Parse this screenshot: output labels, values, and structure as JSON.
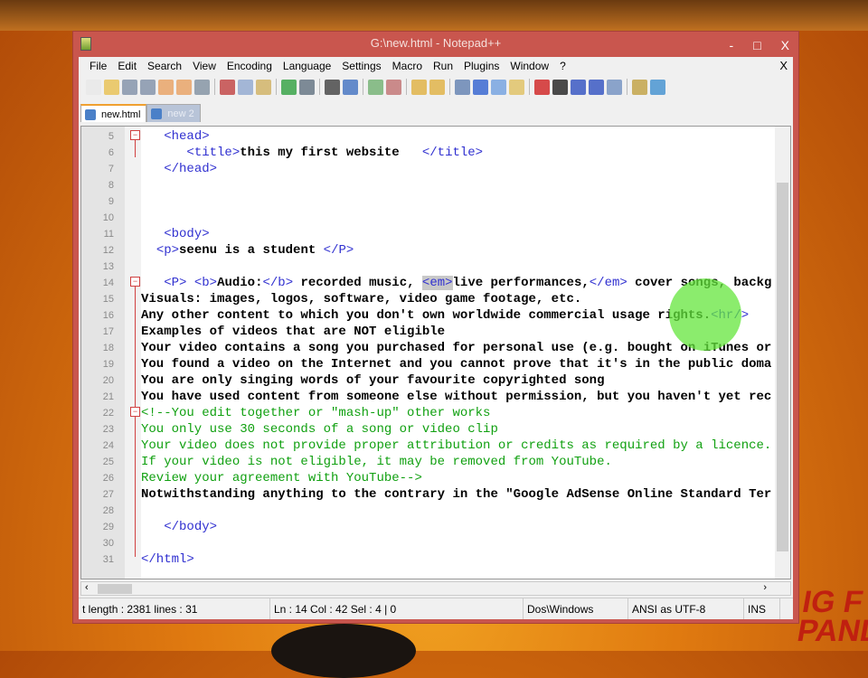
{
  "window": {
    "title": "G:\\new.html - Notepad++",
    "minimize": "-",
    "maximize": "□",
    "close": "X"
  },
  "menu": [
    "File",
    "Edit",
    "Search",
    "View",
    "Encoding",
    "Language",
    "Settings",
    "Macro",
    "Run",
    "Plugins",
    "Window",
    "?"
  ],
  "menu_close": "X",
  "tabs": [
    {
      "label": "new.html",
      "active": true
    },
    {
      "label": "new 2",
      "active": false
    }
  ],
  "editor": {
    "lines": [
      {
        "n": "5",
        "indent": "   ",
        "segs": [
          [
            "t",
            "<head>"
          ]
        ]
      },
      {
        "n": "6",
        "indent": "      ",
        "segs": [
          [
            "t",
            "<title>"
          ],
          [
            "x",
            "this my first website   "
          ],
          [
            "t",
            "</title>"
          ]
        ]
      },
      {
        "n": "7",
        "indent": "   ",
        "segs": [
          [
            "t",
            "</head>"
          ]
        ]
      },
      {
        "n": "8",
        "indent": "",
        "segs": []
      },
      {
        "n": "9",
        "indent": "",
        "segs": []
      },
      {
        "n": "10",
        "indent": "",
        "segs": []
      },
      {
        "n": "11",
        "indent": "   ",
        "segs": [
          [
            "t",
            "<body>"
          ]
        ]
      },
      {
        "n": "12",
        "indent": "  ",
        "segs": [
          [
            "t",
            "<p>"
          ],
          [
            "x",
            "seenu is a student "
          ],
          [
            "t",
            "</P>"
          ]
        ]
      },
      {
        "n": "13",
        "indent": "",
        "segs": []
      },
      {
        "n": "14",
        "indent": "   ",
        "segs": [
          [
            "t",
            "<P>"
          ],
          [
            "x",
            " "
          ],
          [
            "t",
            "<b>"
          ],
          [
            "x",
            "Audio:"
          ],
          [
            "t",
            "</b>"
          ],
          [
            "x",
            " recorded music, "
          ],
          [
            "h",
            "<em>"
          ],
          [
            "x",
            "live performances,"
          ],
          [
            "t",
            "</em>"
          ],
          [
            "x",
            " cover songs, backg"
          ]
        ]
      },
      {
        "n": "15",
        "indent": "",
        "segs": [
          [
            "x",
            "Visuals: images, logos, software, video game footage, etc."
          ]
        ]
      },
      {
        "n": "16",
        "indent": "",
        "segs": [
          [
            "x",
            "Any other content to which you don't own worldwide commercial usage rights."
          ],
          [
            "t",
            "<hr/>"
          ]
        ]
      },
      {
        "n": "17",
        "indent": "",
        "segs": [
          [
            "x",
            "Examples of videos that are NOT eligible"
          ]
        ]
      },
      {
        "n": "18",
        "indent": "",
        "segs": [
          [
            "x",
            "Your video contains a song you purchased for personal use (e.g. bought on iTunes or"
          ]
        ]
      },
      {
        "n": "19",
        "indent": "",
        "segs": [
          [
            "x",
            "You found a video on the Internet and you cannot prove that it's in the public doma"
          ]
        ]
      },
      {
        "n": "20",
        "indent": "",
        "segs": [
          [
            "x",
            "You are only singing words of your favourite copyrighted song"
          ]
        ]
      },
      {
        "n": "21",
        "indent": "",
        "segs": [
          [
            "x",
            "You have used content from someone else without permission, but you haven't yet rec"
          ]
        ]
      },
      {
        "n": "22",
        "indent": "",
        "segs": [
          [
            "c",
            "<!--You edit together or \"mash-up\" other works"
          ]
        ]
      },
      {
        "n": "23",
        "indent": "",
        "segs": [
          [
            "c",
            "You only use 30 seconds of a song or video clip"
          ]
        ]
      },
      {
        "n": "24",
        "indent": "",
        "segs": [
          [
            "c",
            "Your video does not provide proper attribution or credits as required by a licence."
          ]
        ]
      },
      {
        "n": "25",
        "indent": "",
        "segs": [
          [
            "c",
            "If your video is not eligible, it may be removed from YouTube."
          ]
        ]
      },
      {
        "n": "26",
        "indent": "",
        "segs": [
          [
            "c",
            "Review your agreement with YouTube-->"
          ]
        ]
      },
      {
        "n": "27",
        "indent": "",
        "segs": [
          [
            "x",
            "Notwithstanding anything to the contrary in the \"Google AdSense Online Standard Ter"
          ]
        ]
      },
      {
        "n": "28",
        "indent": "",
        "segs": []
      },
      {
        "n": "29",
        "indent": "   ",
        "segs": [
          [
            "t",
            "</body>"
          ]
        ]
      },
      {
        "n": "30",
        "indent": "",
        "segs": []
      },
      {
        "n": "31",
        "indent": "",
        "segs": [
          [
            "t",
            "</html>"
          ]
        ]
      }
    ]
  },
  "status": {
    "length": "t length : 2381    lines : 31",
    "position": "Ln : 14    Col : 42    Sel : 4 | 0",
    "eol": "Dos\\Windows",
    "encoding": "ANSI as UTF-8",
    "mode": "INS"
  },
  "toolbar_icons": [
    "new",
    "open",
    "save",
    "save-all",
    "close",
    "close-all",
    "print",
    "cut",
    "copy",
    "paste",
    "undo",
    "redo",
    "find",
    "replace",
    "zoom-in",
    "zoom-out",
    "sync-v",
    "sync-h",
    "wrap",
    "all-chars",
    "indent-guide",
    "doc-map",
    "record",
    "stop",
    "play",
    "play-multi",
    "save-macro",
    "launch",
    "spellcheck"
  ]
}
